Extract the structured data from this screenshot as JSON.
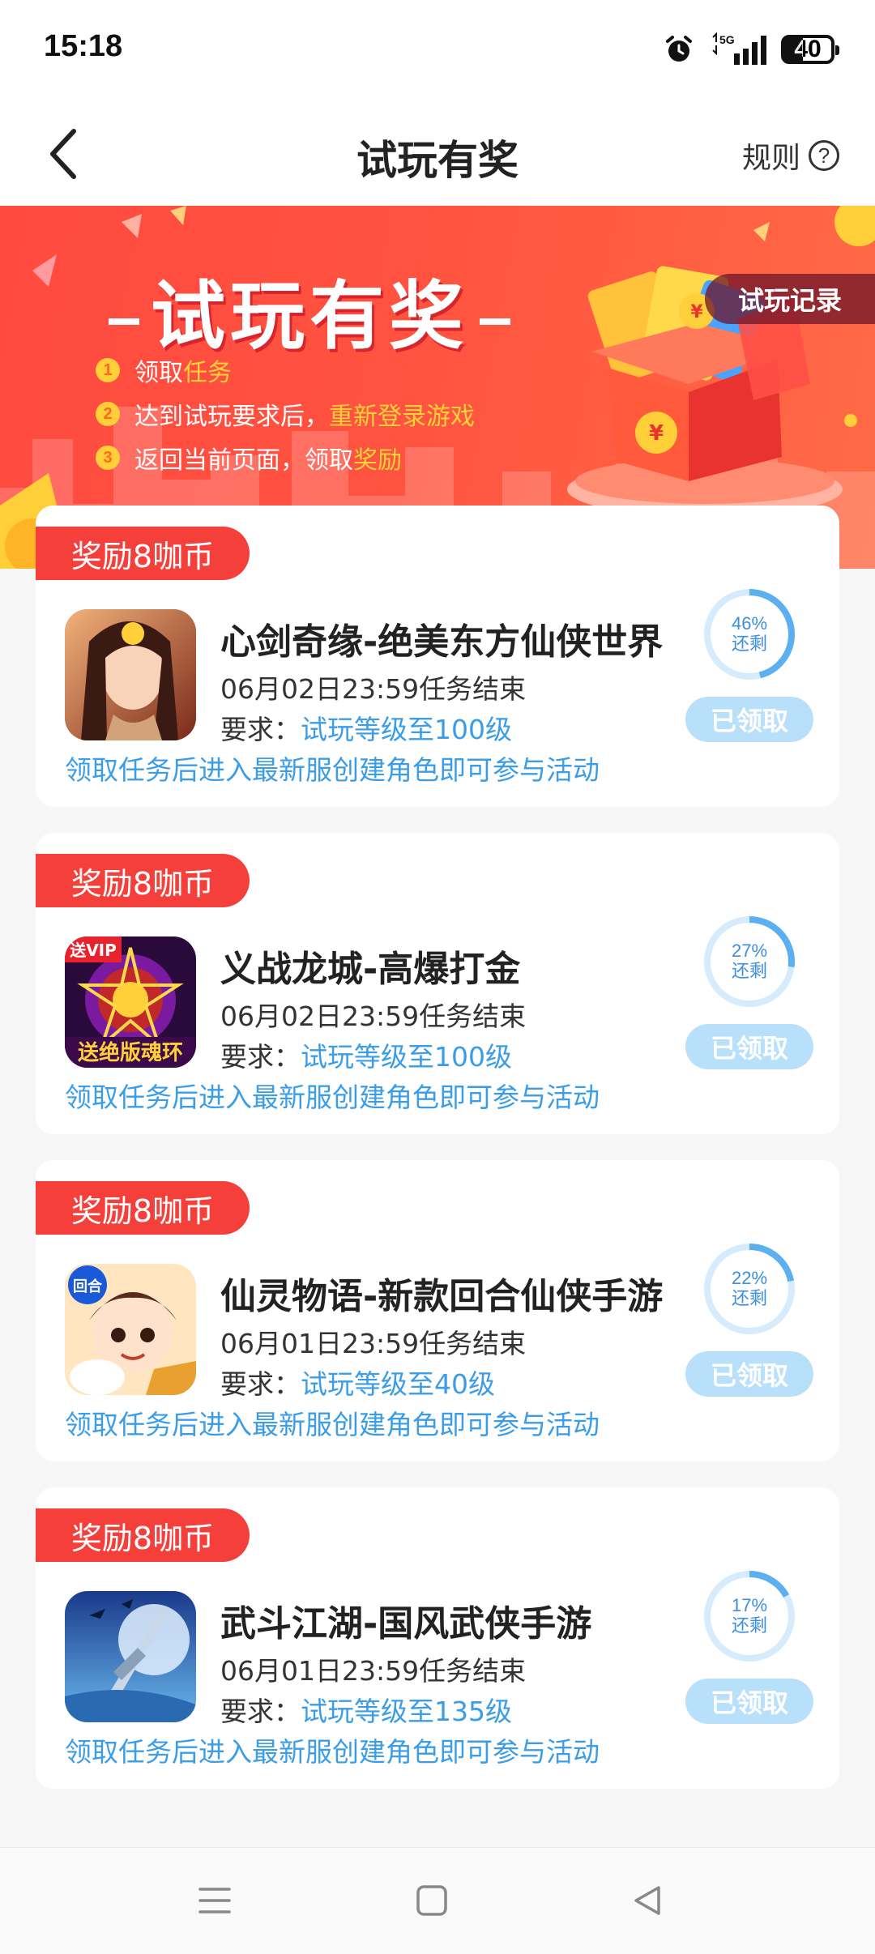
{
  "status_bar": {
    "time": "15:18",
    "network": "5G",
    "battery": "40",
    "battery_level": 0.4
  },
  "header": {
    "title": "试玩有奖",
    "rules_label": "规则",
    "help_glyph": "?"
  },
  "banner": {
    "title": "试玩有奖",
    "record_button": "试玩记录",
    "steps": [
      {
        "num": "1",
        "text": "领取",
        "highlight": "任务"
      },
      {
        "num": "2",
        "text": "达到试玩要求后，",
        "highlight": "重新登录游戏"
      },
      {
        "num": "3",
        "text": "返回当前页面，领取",
        "highlight": "奖励"
      }
    ]
  },
  "tasks": [
    {
      "reward": "奖励8咖币",
      "name": "心剑奇缘-绝美东方仙侠世界",
      "deadline": "06月02日23:59任务结束",
      "req_label": "要求：",
      "req_value": "试玩等级至100级",
      "note": "领取任务后进入最新服创建角色即可参与活动",
      "percent": "46%",
      "percent_value": 46,
      "remain": "还剩",
      "button": "已领取"
    },
    {
      "reward": "奖励8咖币",
      "name": "义战龙城-高爆打金",
      "deadline": "06月02日23:59任务结束",
      "req_label": "要求：",
      "req_value": "试玩等级至100级",
      "note": "领取任务后进入最新服创建角色即可参与活动",
      "percent": "27%",
      "percent_value": 27,
      "remain": "还剩",
      "button": "已领取",
      "icon_text_top": "送VIP",
      "icon_text_bottom": "送绝版魂环"
    },
    {
      "reward": "奖励8咖币",
      "name": "仙灵物语-新款回合仙侠手游",
      "deadline": "06月01日23:59任务结束",
      "req_label": "要求：",
      "req_value": "试玩等级至40级",
      "note": "领取任务后进入最新服创建角色即可参与活动",
      "percent": "22%",
      "percent_value": 22,
      "remain": "还剩",
      "button": "已领取",
      "icon_text_top": "回合"
    },
    {
      "reward": "奖励8咖币",
      "name": "武斗江湖-国风武侠手游",
      "deadline": "06月01日23:59任务结束",
      "req_label": "要求：",
      "req_value": "试玩等级至135级",
      "note": "领取任务后进入最新服创建角色即可参与活动",
      "percent": "17%",
      "percent_value": 17,
      "remain": "还剩",
      "button": "已领取"
    }
  ],
  "colors": {
    "accent_red": "#f43f3a",
    "link_blue": "#3b9de8",
    "claimed_bg": "#b9e0fb"
  },
  "icons": {
    "back": "chevron-left-icon",
    "help": "question-circle-icon",
    "nav": [
      "menu-icon",
      "home-square-icon",
      "back-triangle-icon"
    ]
  }
}
